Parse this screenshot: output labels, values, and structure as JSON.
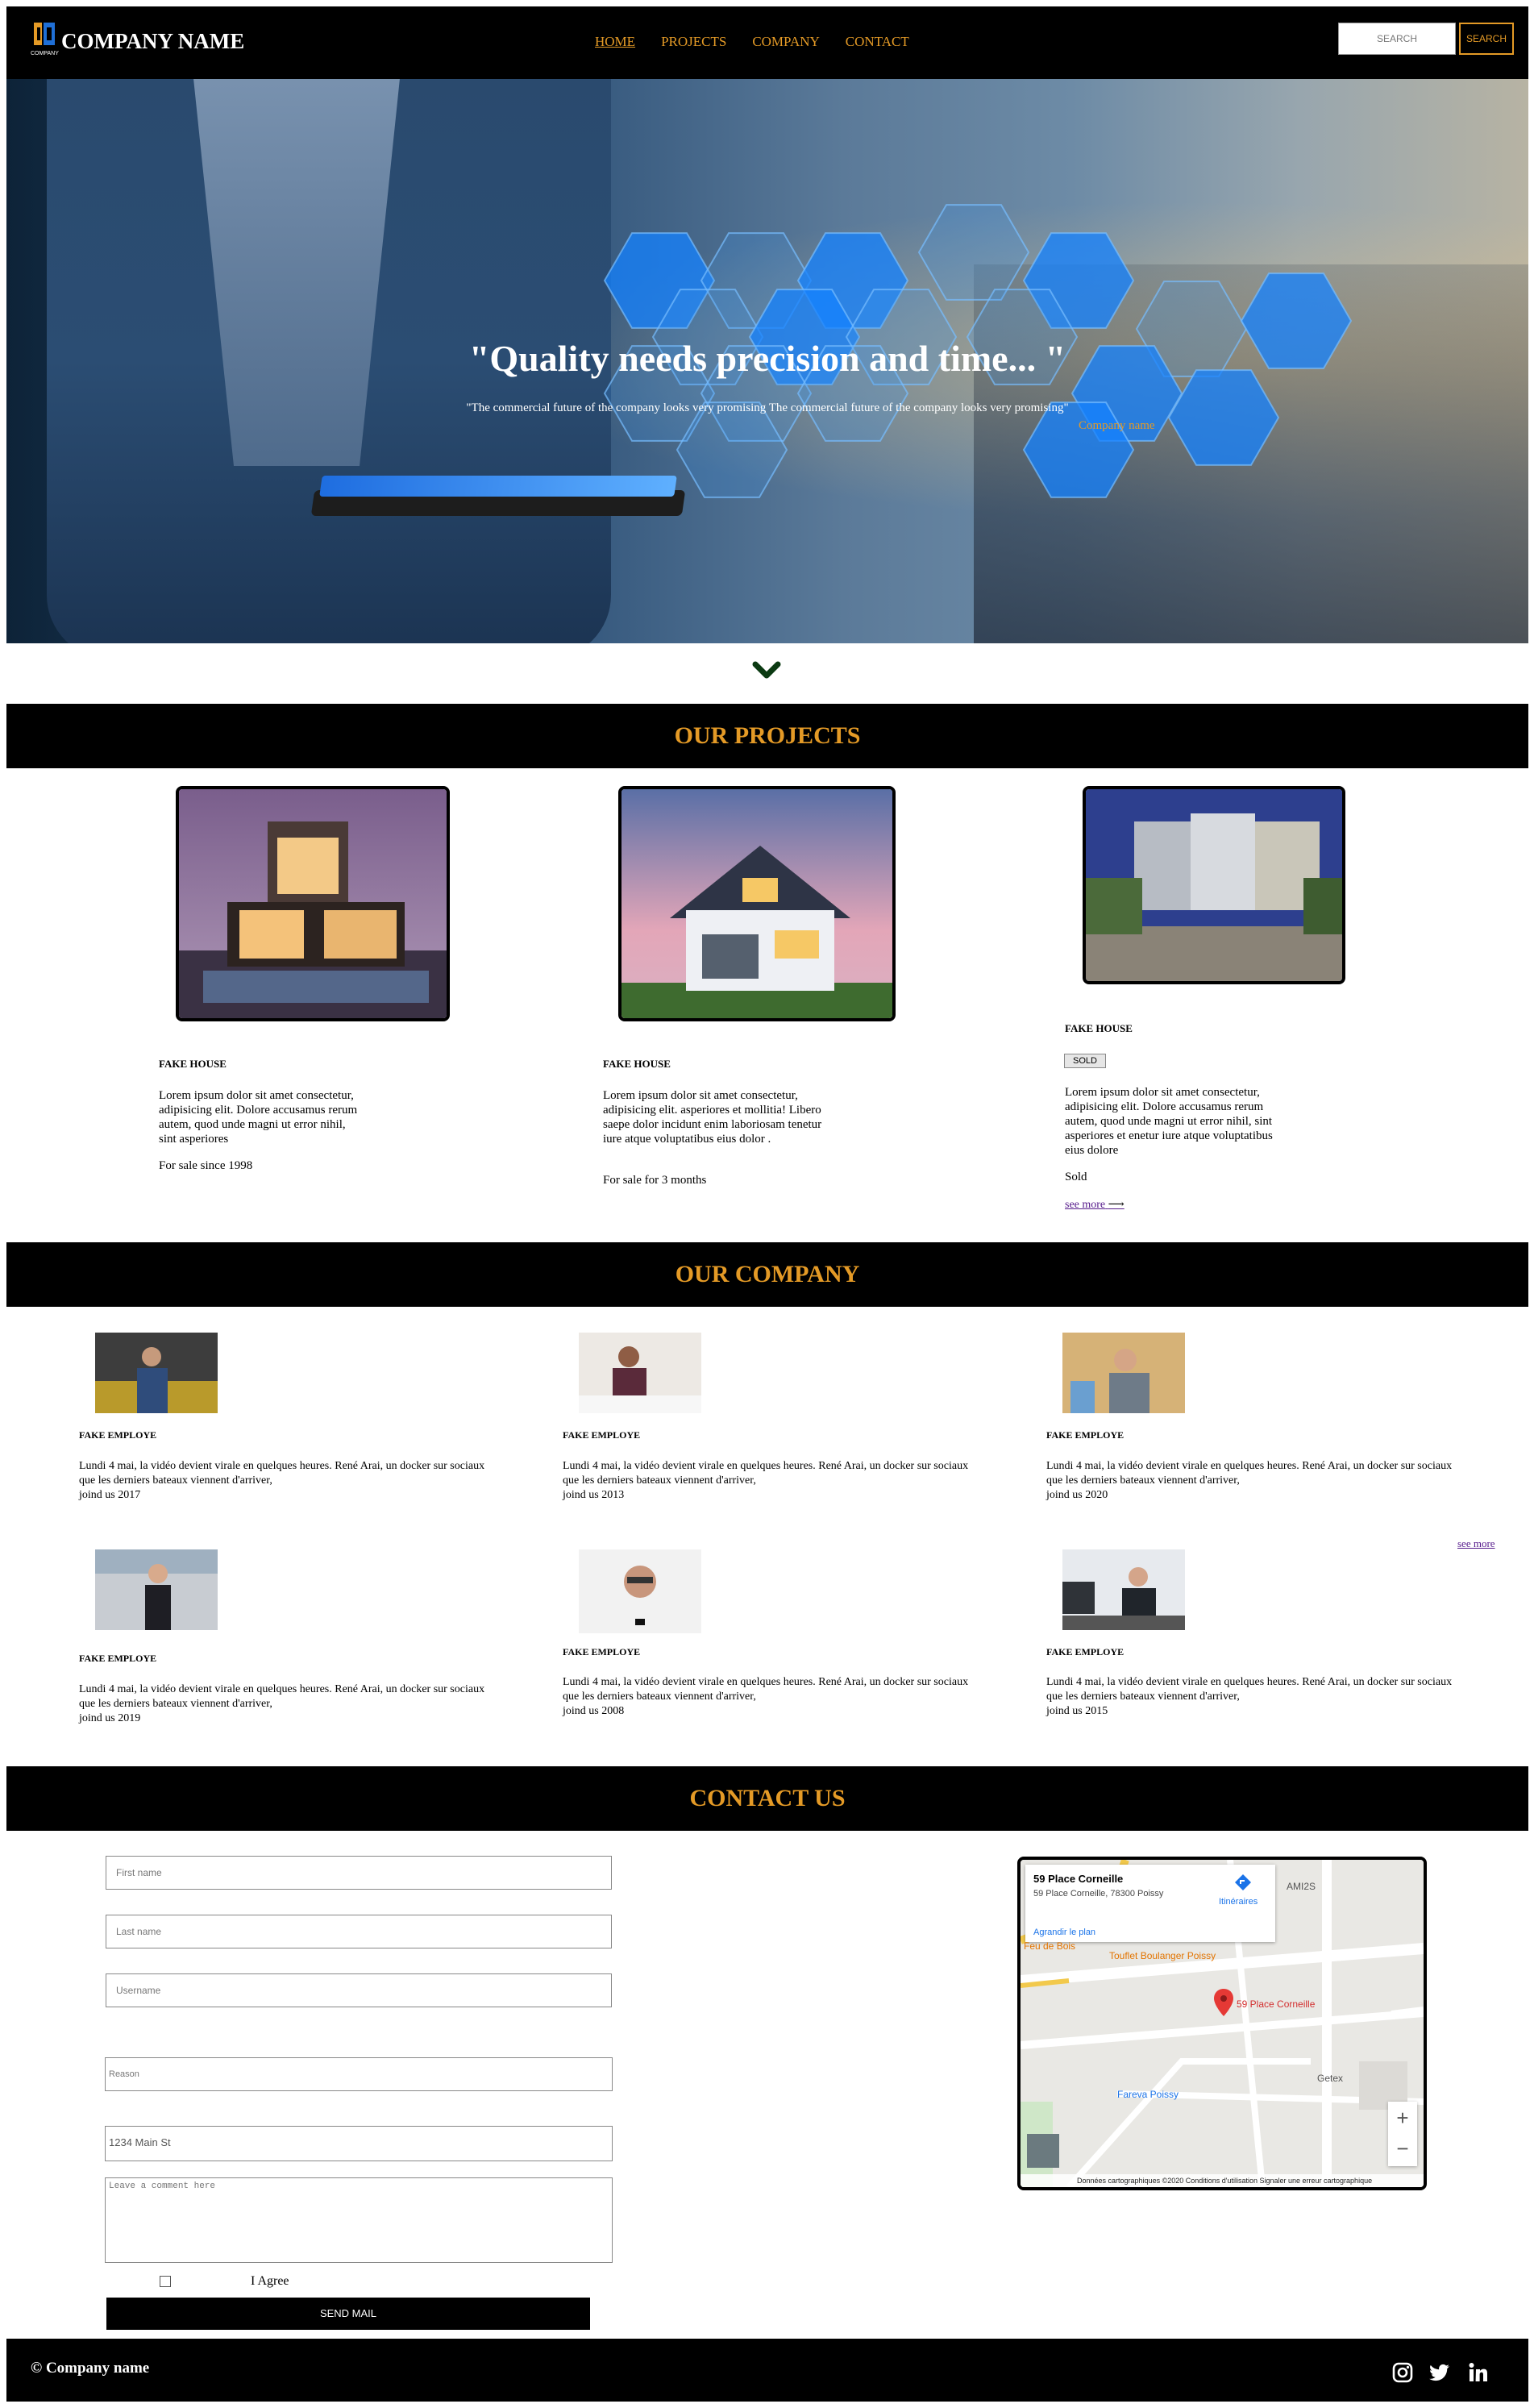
{
  "nav": {
    "brand": "COMPANY NAME",
    "logo_text": "COMPANY",
    "items": [
      {
        "label": "HOME",
        "active": true
      },
      {
        "label": "PROJECTS",
        "active": false
      },
      {
        "label": "COMPANY",
        "active": false
      },
      {
        "label": "CONTACT",
        "active": false
      }
    ],
    "search_placeholder": "SEARCH",
    "search_button": "SEARCH"
  },
  "hero": {
    "quote": "\"Quality needs precision and time... \"",
    "subquote": "\"The commercial future of the company looks very promising The commercial future of the company looks very promising\"",
    "author": "Company name"
  },
  "projects": {
    "heading": "OUR PROJECTS",
    "items": [
      {
        "title": "FAKE HOUSE",
        "description": "Lorem ipsum dolor sit amet consectetur, adipisicing elit. Dolore accusamus rerum autem, quod unde magni ut error nihil, sint asperiores",
        "status": "For sale since 1998"
      },
      {
        "title": "FAKE HOUSE",
        "description": "Lorem ipsum dolor sit amet consectetur, adipisicing elit. asperiores et mollitia! Libero saepe dolor incidunt enim laboriosam tenetur iure atque voluptatibus eius dolor .",
        "status": "For sale for 3 months"
      },
      {
        "title": "FAKE HOUSE",
        "badge": "SOLD",
        "description": "Lorem ipsum dolor sit amet consectetur, adipisicing elit. Dolore accusamus rerum autem, quod unde magni ut error nihil, sint asperiores et enetur iure atque voluptatibus eius dolore",
        "status": "Sold",
        "link": "see more"
      }
    ]
  },
  "company": {
    "heading": "OUR COMPANY",
    "see_more": "see more",
    "employees": [
      {
        "title": "FAKE EMPLOYE",
        "text": "Lundi 4 mai, la vidéo devient virale en quelques heures. René Arai, un docker sur sociaux que les derniers bateaux viennent d'arriver,",
        "joined": "joind us 2017"
      },
      {
        "title": "FAKE EMPLOYE",
        "text": "Lundi 4 mai, la vidéo devient virale en quelques heures. René Arai, un docker sur sociaux que les derniers bateaux viennent d'arriver,",
        "joined": "joind us 2013"
      },
      {
        "title": "FAKE EMPLOYE",
        "text": "Lundi 4 mai, la vidéo devient virale en quelques heures. René Arai, un docker sur sociaux que les derniers bateaux viennent d'arriver,",
        "joined": "joind us 2020"
      },
      {
        "title": "FAKE EMPLOYE",
        "text": "Lundi 4 mai, la vidéo devient virale en quelques heures. René Arai, un docker sur sociaux que les derniers bateaux viennent d'arriver,",
        "joined": "joind us 2019"
      },
      {
        "title": "FAKE EMPLOYE",
        "text": "Lundi 4 mai, la vidéo devient virale en quelques heures. René Arai, un docker sur sociaux que les derniers bateaux viennent d'arriver,",
        "joined": "joind us 2008"
      },
      {
        "title": "FAKE EMPLOYE",
        "text": "Lundi 4 mai, la vidéo devient virale en quelques heures. René Arai, un docker sur sociaux que les derniers bateaux viennent d'arriver,",
        "joined": "joind us 2015"
      }
    ]
  },
  "contact": {
    "heading": "CONTACT US",
    "first_name_placeholder": "First name",
    "last_name_placeholder": "Last name",
    "username_placeholder": "Username",
    "reason_placeholder": "Reason",
    "address_placeholder": "1234 Main St",
    "comment_placeholder": "Leave a comment here",
    "agree_label": "I Agree",
    "send_label": "SEND MAIL",
    "map": {
      "place_title": "59 Place Corneille",
      "place_address": "59 Place Corneille, 78300 Poissy",
      "directions": "Itinéraires",
      "enlarge": "Agrandir le plan",
      "pin_label": "59 Place Corneille",
      "poi_1": "Touflet Boulanger Poissy",
      "poi_2": "Fareva Poissy",
      "poi_3": "Getex",
      "poi_4": "AMI2S",
      "poi_5": "Feu de Bois",
      "footer": "Données cartographiques ©2020    Conditions d'utilisation    Signaler une erreur cartographique"
    }
  },
  "footer": {
    "copyright": "© Company name",
    "social": [
      "instagram-icon",
      "twitter-icon",
      "linkedin-icon"
    ]
  },
  "colors": {
    "accent": "#e49a26",
    "bar": "#000000"
  }
}
